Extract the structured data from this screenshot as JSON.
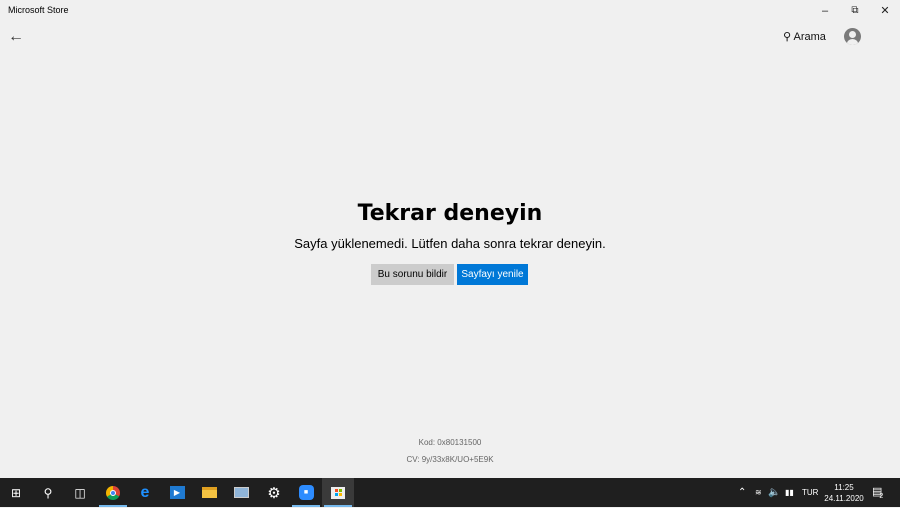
{
  "window": {
    "title": "Microsoft Store"
  },
  "header": {
    "search_label": "Arama"
  },
  "error": {
    "title": "Tekrar deneyin",
    "message": "Sayfa yüklenemedi. Lütfen daha sonra tekrar deneyin.",
    "report_button": "Bu sorunu bildir",
    "refresh_button": "Sayfayı yenile",
    "code": "Kod: 0x80131500",
    "cv": "CV: 9y/33x8K/UO+5E9K"
  },
  "taskbar": {
    "apps": [
      "start",
      "search",
      "task-view",
      "chrome",
      "edge",
      "media-player",
      "file-explorer",
      "network-app",
      "settings",
      "zoom",
      "microsoft-store"
    ],
    "language": "TUR",
    "time": "11:25",
    "date": "24.11.2020",
    "notification_count": "2"
  },
  "colors": {
    "accent": "#0078d7",
    "taskbar": "#1f1f1f"
  }
}
